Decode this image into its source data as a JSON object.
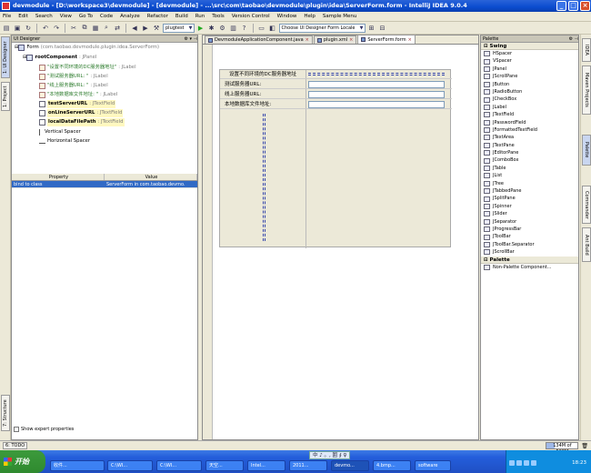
{
  "window": {
    "title": "devmodule - [D:\\workspace3\\devmodule] - [devmodule] - ...\\src\\com\\taobao\\devmodule\\plugin\\idea\\ServerForm.form - IntelliJ IDEA 9.0.4"
  },
  "menu": [
    "File",
    "Edit",
    "Search",
    "View",
    "Go To",
    "Code",
    "Analyze",
    "Refactor",
    "Build",
    "Run",
    "Tools",
    "Version Control",
    "Window",
    "Help",
    "Sample Menu"
  ],
  "toolbar": {
    "run_config": "plugtest",
    "designer_action": "Choose UI Designer Form Locale"
  },
  "left_tabs": [
    "1: UI Designer",
    "1: Project",
    "7: Structure"
  ],
  "ui_designer": {
    "title": "UI Designer",
    "tree": {
      "root": "Form",
      "root_detail": "(com.taobao.devmodule.plugin.idea.ServerForm)",
      "panel": "rootComponent",
      "panel_type": ": JPanel",
      "items": [
        {
          "text": "\"设置不同环境的DC服务器地址\"",
          "type": ": JLabel",
          "kind": "label"
        },
        {
          "text": "\"测试服务器URL: \"",
          "type": ": JLabel",
          "kind": "label"
        },
        {
          "text": "\"线上服务器URL: \"",
          "type": ": JLabel",
          "kind": "label"
        },
        {
          "text": "\"本地数据库文件地址: \"",
          "type": ": JLabel",
          "kind": "label"
        },
        {
          "text": "testServerURL",
          "type": ": JTextField",
          "kind": "field"
        },
        {
          "text": "onLineServerURL",
          "type": ": JTextField",
          "kind": "field"
        },
        {
          "text": "localDataFilePath",
          "type": ": JTextField",
          "kind": "field"
        },
        {
          "text": "Vertical Spacer",
          "type": "",
          "kind": "vsp"
        },
        {
          "text": "Horizontal Spacer",
          "type": "",
          "kind": "hsp"
        }
      ]
    },
    "properties": {
      "headers": [
        "Property",
        "Value"
      ],
      "rows": [
        {
          "property": "bind to class",
          "value": "ServerForm in com.taobao.devmo."
        }
      ]
    },
    "show_expert": "Show expert properties"
  },
  "editor": {
    "tabs": [
      {
        "label": "DevmoduleApplicationComponent.java",
        "active": false
      },
      {
        "label": "plugin.xml",
        "active": false
      },
      {
        "label": "ServerForm.form",
        "active": true
      }
    ],
    "form_rows": [
      {
        "label": "设置不同环境的DC服务器地址",
        "has_field": false
      },
      {
        "label": "测试服务器URL:",
        "has_field": true
      },
      {
        "label": "线上服务器URL:",
        "has_field": true
      },
      {
        "label": "本地数据库文件地址:",
        "has_field": true
      }
    ]
  },
  "palette": {
    "title": "Palette",
    "group_swing": "Swing",
    "items": [
      "HSpacer",
      "VSpacer",
      "JPanel",
      "JScrollPane",
      "JButton",
      "JRadioButton",
      "JCheckBox",
      "JLabel",
      "JTextField",
      "JPasswordField",
      "JFormattedTextField",
      "JTextArea",
      "JTextPane",
      "JEditorPane",
      "JComboBox",
      "JTable",
      "JList",
      "JTree",
      "JTabbedPane",
      "JSplitPane",
      "JSpinner",
      "JSlider",
      "JSeparator",
      "JProgressBar",
      "JToolBar",
      "JToolBar.Separator",
      "JScrollBar"
    ],
    "group_palette": "Palette",
    "extra_item": "Non-Palette Component..."
  },
  "right_tabs": [
    "IDEA",
    "Maven Projects",
    "Palette",
    "Commander",
    "Ant Build"
  ],
  "status": {
    "todo": "6: TODO",
    "memory": "134M of 508M",
    "memory_fraction": 0.26
  },
  "taskbar": {
    "start": "开始",
    "ime": "中 ♪ 。, 囲 ∮ ♀",
    "tasks": [
      "收件...",
      "C:\\WI...",
      "C:\\WI...",
      "天空...",
      "Intel...",
      "2011...",
      "devmo...",
      "4.bmp...",
      "software"
    ],
    "clock": "18:23"
  },
  "colors": {
    "title_bar": "#0b4ccf",
    "selection": "#316ac5",
    "taskbar": "#245edb",
    "start": "#2f8a2f"
  }
}
